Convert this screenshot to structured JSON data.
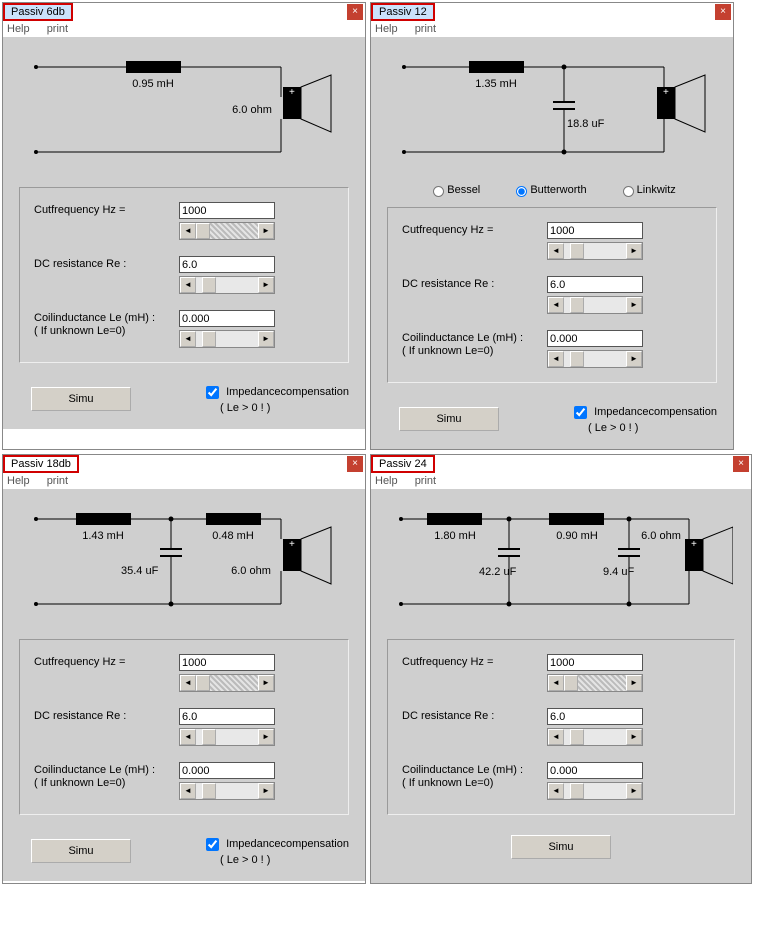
{
  "common": {
    "menu": {
      "help": "Help",
      "print": "print"
    },
    "labels": {
      "cutfreq": "Cutfrequency   Hz   =",
      "dcres": "DC resistance  Re   :",
      "coil_l": "Coilinductance Le (mH)  :",
      "coil_l2": " ( If unknown   Le=0)",
      "simu": "Simu",
      "imp": "Impedancecompensation",
      "imp2": "( Le > 0 ! )"
    },
    "filters": {
      "bessel": "Bessel",
      "butter": "Butterworth",
      "linkwitz": "Linkwitz"
    }
  },
  "p6": {
    "title": "Passiv 6db",
    "l1": "0.95 mH",
    "r": "6.0 ohm",
    "cutfreq": "1000",
    "dcres": "6.0",
    "coil": "0.000",
    "imp_checked": true
  },
  "p12": {
    "title": "Passiv 12",
    "l1": "1.35 mH",
    "c1": "18.8 uF",
    "cutfreq": "1000",
    "dcres": "6.0",
    "coil": "0.000",
    "imp_checked": true,
    "filter_sel": "butter"
  },
  "p18": {
    "title": "Passiv 18db",
    "l1": "1.43 mH",
    "l2": "0.48 mH",
    "c1": "35.4 uF",
    "r": "6.0 ohm",
    "cutfreq": "1000",
    "dcres": "6.0",
    "coil": "0.000",
    "imp_checked": true
  },
  "p24": {
    "title": "Passiv 24",
    "l1": "1.80 mH",
    "l2": "0.90 mH",
    "c1": "42.2 uF",
    "c2": "9.4 uF",
    "r": "6.0 ohm",
    "cutfreq": "1000",
    "dcres": "6.0",
    "coil": "0.000"
  }
}
